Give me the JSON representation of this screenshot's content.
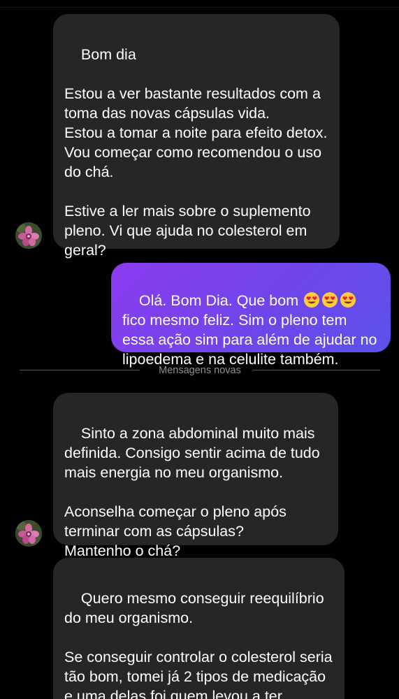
{
  "thread": {
    "messages": [
      {
        "id": "m1",
        "direction": "incoming",
        "text": "Bom dia\n\nEstou a ver bastante resultados com a toma das novas cápsulas vida.\nEstou a tomar a noite para efeito detox.\nVou começar como recomendou o uso do chá.\n\nEstive a ler mais sobre o suplemento pleno. Vi que ajuda no colesterol em geral?"
      },
      {
        "id": "m2",
        "direction": "outgoing",
        "text_before_emoji": "Olá. Bom Dia. Que bom ",
        "emoji": "smiling-face-with-heart-eyes",
        "emoji_count": 3,
        "text_after_emoji": " fico mesmo feliz. Sim o pleno tem essa ação sim para além de ajudar no lipoedema e na celulite também."
      },
      {
        "id": "m3",
        "direction": "incoming",
        "text": "Sinto a zona abdominal muito mais definida. Consigo sentir acima de tudo mais energia no meu organismo.\n\nAconselha começar o pleno após terminar com as cápsulas?\nMantenho o chá?"
      },
      {
        "id": "m4",
        "direction": "incoming",
        "text": "Quero mesmo conseguir reequilíbrio do meu organismo.\n\nSe conseguir controlar o colesterol seria tão bom, tomei já 2 tipos de medicação e uma delas foi quem levou a ter retenção de líquidos e engordei."
      }
    ],
    "new_messages_divider": "Mensagens novas"
  },
  "colors": {
    "background": "#000000",
    "incoming_bubble": "#262629",
    "outgoing_bubble_start": "#8b3cf0",
    "outgoing_bubble_end": "#5a52ec",
    "divider_text": "#8e8e93"
  }
}
